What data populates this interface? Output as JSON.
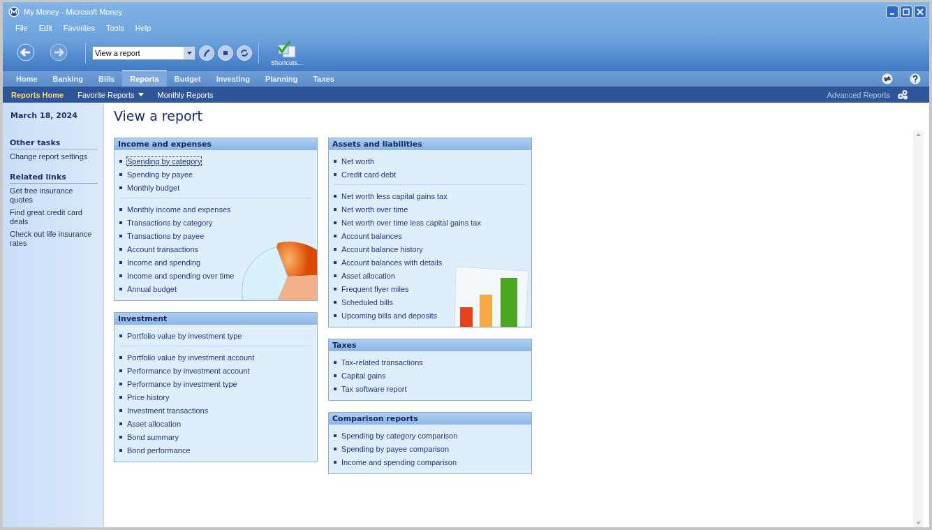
{
  "window": {
    "title": "My Money - Microsoft Money"
  },
  "menu": [
    "File",
    "Edit",
    "Favorites",
    "Tools",
    "Help"
  ],
  "toolbar": {
    "address": "View a report",
    "shortcuts_label": "Shortcuts..."
  },
  "tabs": [
    {
      "label": "Home",
      "selected": false
    },
    {
      "label": "Banking",
      "selected": false
    },
    {
      "label": "Bills",
      "selected": false
    },
    {
      "label": "Reports",
      "selected": true
    },
    {
      "label": "Budget",
      "selected": false
    },
    {
      "label": "Investing",
      "selected": false
    },
    {
      "label": "Planning",
      "selected": false
    },
    {
      "label": "Taxes",
      "selected": false
    }
  ],
  "subnav": {
    "items": [
      {
        "label": "Reports Home",
        "selected": true,
        "has_menu": false
      },
      {
        "label": "Favorite Reports",
        "selected": false,
        "has_menu": true
      },
      {
        "label": "Monthly Reports",
        "selected": false,
        "has_menu": false
      }
    ],
    "right_link": "Advanced Reports"
  },
  "sidebar": {
    "date": "March 18, 2024",
    "sections": [
      {
        "title": "Other tasks",
        "links": [
          "Change report settings"
        ]
      },
      {
        "title": "Related links",
        "links": [
          "Get free insurance quotes",
          "Find great credit card deals",
          "Check out life insurance rates"
        ]
      }
    ]
  },
  "page_title": "View a report",
  "columns": [
    [
      {
        "title": "Income and expenses",
        "kind": "pie",
        "groups": [
          [
            {
              "label": "Spending by category",
              "focused": true
            },
            {
              "label": "Spending by payee",
              "focused": false
            },
            {
              "label": "Monthly budget",
              "focused": false
            }
          ],
          [
            {
              "label": "Monthly income and expenses",
              "focused": false
            },
            {
              "label": "Transactions by category",
              "focused": false
            },
            {
              "label": "Transactions by payee",
              "focused": false
            },
            {
              "label": "Account transactions",
              "focused": false
            },
            {
              "label": "Income and spending",
              "focused": false
            },
            {
              "label": "Income and spending over time",
              "focused": false
            },
            {
              "label": "Annual budget",
              "focused": false
            }
          ]
        ]
      },
      {
        "title": "Investment",
        "kind": "plain",
        "groups": [
          [
            {
              "label": "Portfolio value by investment type",
              "focused": false
            }
          ],
          [
            {
              "label": "Portfolio value by investment account",
              "focused": false
            },
            {
              "label": "Performance by investment account",
              "focused": false
            },
            {
              "label": "Performance by investment type",
              "focused": false
            },
            {
              "label": "Price history",
              "focused": false
            },
            {
              "label": "Investment transactions",
              "focused": false
            },
            {
              "label": "Asset allocation",
              "focused": false
            },
            {
              "label": "Bond summary",
              "focused": false
            },
            {
              "label": "Bond performance",
              "focused": false
            }
          ]
        ]
      }
    ],
    [
      {
        "title": "Assets and liabilities",
        "kind": "bars",
        "groups": [
          [
            {
              "label": "Net worth",
              "focused": false
            },
            {
              "label": "Credit card debt",
              "focused": false
            }
          ],
          [
            {
              "label": "Net worth less capital gains tax",
              "focused": false
            },
            {
              "label": "Net worth over time",
              "focused": false
            },
            {
              "label": "Net worth over time less capital gains tax",
              "focused": false
            },
            {
              "label": "Account balances",
              "focused": false
            },
            {
              "label": "Account balance history",
              "focused": false
            },
            {
              "label": "Account balances with details",
              "focused": false
            },
            {
              "label": "Asset allocation",
              "focused": false
            },
            {
              "label": "Frequent flyer miles",
              "focused": false
            },
            {
              "label": "Scheduled bills",
              "focused": false
            },
            {
              "label": "Upcoming bills and deposits",
              "focused": false
            }
          ]
        ]
      },
      {
        "title": "Taxes",
        "kind": "plain",
        "groups": [
          [
            {
              "label": "Tax-related transactions",
              "focused": false
            },
            {
              "label": "Capital gains",
              "focused": false
            },
            {
              "label": "Tax software report",
              "focused": false
            }
          ]
        ]
      },
      {
        "title": "Comparison reports",
        "kind": "plain",
        "groups": [
          [
            {
              "label": "Spending by category comparison",
              "focused": false
            },
            {
              "label": "Spending by payee comparison",
              "focused": false
            },
            {
              "label": "Income and spending comparison",
              "focused": false
            }
          ]
        ]
      }
    ]
  ]
}
